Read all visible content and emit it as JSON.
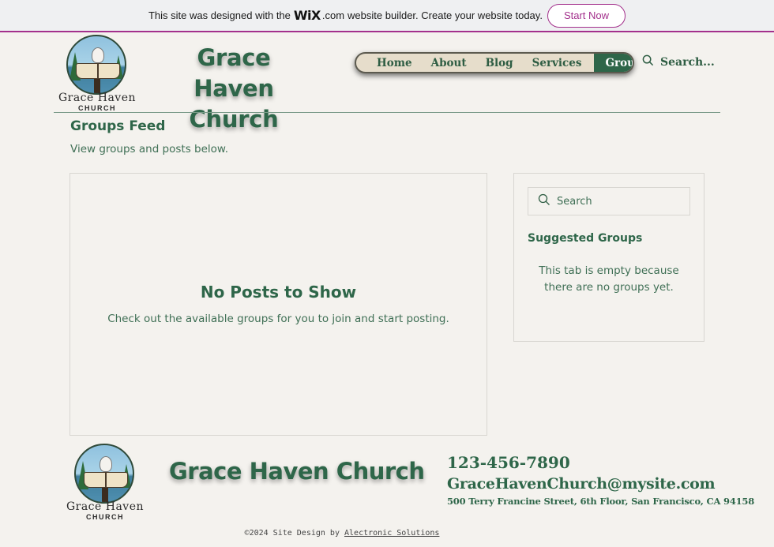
{
  "wix_banner": {
    "text_before": "This site was designed with the",
    "brand": "WiX",
    "brand_suffix": ".com",
    "text_after": "website builder. Create your website today.",
    "cta": "Start Now",
    "accent_color": "#a3308c"
  },
  "header": {
    "logo_line1": "Grace Haven",
    "logo_line2": "CHURCH",
    "title_line1": "Grace Haven",
    "title_line2": "Church",
    "nav": [
      {
        "label": "Home"
      },
      {
        "label": "About"
      },
      {
        "label": "Blog"
      },
      {
        "label": "Services"
      },
      {
        "label": "Groups",
        "active": true
      }
    ],
    "search_label": "Search...",
    "search_icon": "search-icon"
  },
  "main": {
    "title": "Groups Feed",
    "subtitle": "View groups and posts below.",
    "empty_title": "No Posts to Show",
    "empty_text": "Check out the available groups for you to join and start posting."
  },
  "sidebar": {
    "search_placeholder": "Search",
    "suggested_title": "Suggested Groups",
    "empty_text": "This tab is empty because there are no groups yet."
  },
  "footer": {
    "logo_line1": "Grace Haven",
    "logo_line2": "CHURCH",
    "title": "Grace Haven Church",
    "phone": "123-456-7890",
    "email": "GraceHavenChurch@mysite.com",
    "address": "500 Terry Francine Street, 6th Floor, San Francisco, CA 94158",
    "copyright_prefix": "©2024 Site Design by",
    "copyright_link": "Alectronic Solutions"
  },
  "colors": {
    "brand_green": "#2e6649",
    "background": "#f4f2ee",
    "nav_bg": "#e6ddcb"
  }
}
